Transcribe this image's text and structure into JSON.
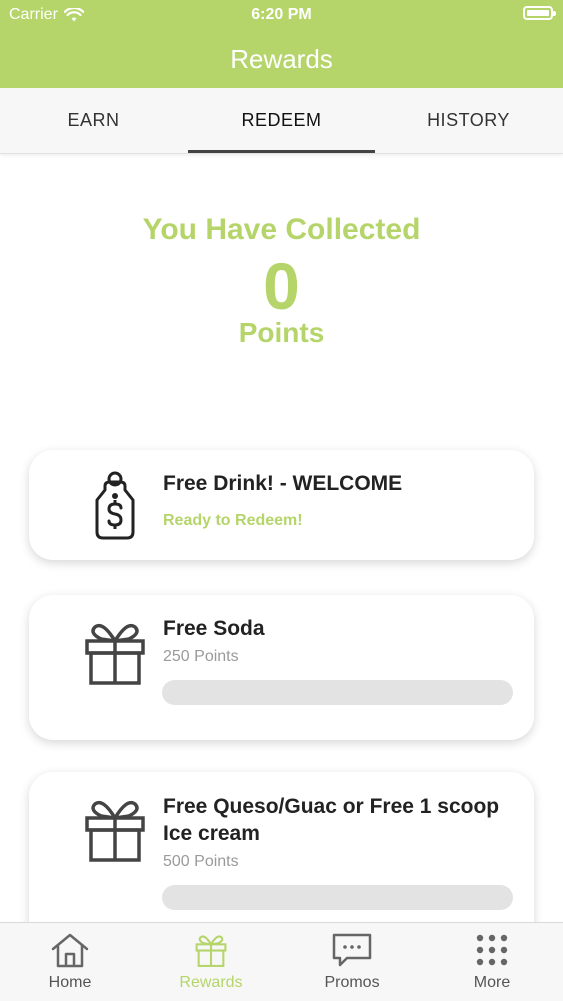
{
  "status_bar": {
    "carrier": "Carrier",
    "time": "6:20 PM"
  },
  "header": {
    "title": "Rewards"
  },
  "tabs": [
    {
      "label": "EARN",
      "active": false
    },
    {
      "label": "REDEEM",
      "active": true
    },
    {
      "label": "HISTORY",
      "active": false
    }
  ],
  "summary": {
    "heading": "You Have Collected",
    "points": "0",
    "unit": "Points"
  },
  "rewards": [
    {
      "title": "Free Drink! - WELCOME",
      "status": "Ready to Redeem!",
      "icon": "price-tag-dollar-icon"
    },
    {
      "title": "Free Soda",
      "points": "250 Points",
      "icon": "gift-icon",
      "progress": 0
    },
    {
      "title": "Free Queso/Guac or Free 1 scoop Ice cream",
      "points": "500 Points",
      "icon": "gift-icon",
      "progress": 0
    }
  ],
  "bottom_nav": [
    {
      "label": "Home",
      "icon": "home-icon",
      "active": false
    },
    {
      "label": "Rewards",
      "icon": "gift-icon",
      "active": true
    },
    {
      "label": "Promos",
      "icon": "chat-bubble-icon",
      "active": false
    },
    {
      "label": "More",
      "icon": "grid-dots-icon",
      "active": false
    }
  ],
  "colors": {
    "brand": "#b5d56a",
    "tab_indicator": "#444444",
    "progress_track": "#e3e3e3"
  }
}
